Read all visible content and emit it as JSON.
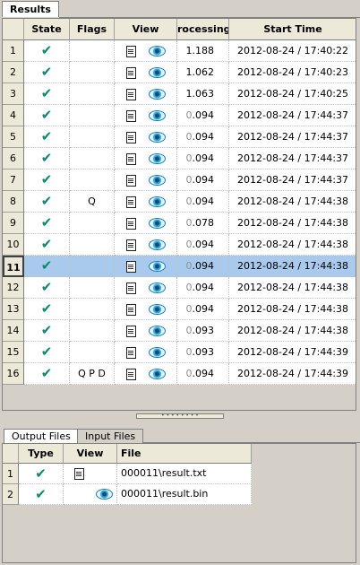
{
  "tabs": {
    "results": "Results"
  },
  "results": {
    "columns": [
      "State",
      "Flags",
      "View",
      "rocessing",
      "Start Time"
    ],
    "rows": [
      {
        "num": "1",
        "flags": "",
        "proc_lead": "",
        "proc": "1.188",
        "time": "2012-08-24 / 17:40:22"
      },
      {
        "num": "2",
        "flags": "",
        "proc_lead": "",
        "proc": "1.062",
        "time": "2012-08-24 / 17:40:23"
      },
      {
        "num": "3",
        "flags": "",
        "proc_lead": "",
        "proc": "1.063",
        "time": "2012-08-24 / 17:40:25"
      },
      {
        "num": "4",
        "flags": "",
        "proc_lead": "0",
        "proc": ".094",
        "time": "2012-08-24 / 17:44:37"
      },
      {
        "num": "5",
        "flags": "",
        "proc_lead": "0",
        "proc": ".094",
        "time": "2012-08-24 / 17:44:37"
      },
      {
        "num": "6",
        "flags": "",
        "proc_lead": "0",
        "proc": ".094",
        "time": "2012-08-24 / 17:44:37"
      },
      {
        "num": "7",
        "flags": "",
        "proc_lead": "0",
        "proc": ".094",
        "time": "2012-08-24 / 17:44:37"
      },
      {
        "num": "8",
        "flags": "Q",
        "proc_lead": "0",
        "proc": ".094",
        "time": "2012-08-24 / 17:44:38"
      },
      {
        "num": "9",
        "flags": "",
        "proc_lead": "0",
        "proc": ".078",
        "time": "2012-08-24 / 17:44:38"
      },
      {
        "num": "10",
        "flags": "",
        "proc_lead": "0",
        "proc": ".094",
        "time": "2012-08-24 / 17:44:38"
      },
      {
        "num": "11",
        "flags": "",
        "proc_lead": "0",
        "proc": ".094",
        "time": "2012-08-24 / 17:44:38"
      },
      {
        "num": "12",
        "flags": "",
        "proc_lead": "0",
        "proc": ".094",
        "time": "2012-08-24 / 17:44:38"
      },
      {
        "num": "13",
        "flags": "",
        "proc_lead": "0",
        "proc": ".094",
        "time": "2012-08-24 / 17:44:38"
      },
      {
        "num": "14",
        "flags": "",
        "proc_lead": "0",
        "proc": ".093",
        "time": "2012-08-24 / 17:44:38"
      },
      {
        "num": "15",
        "flags": "",
        "proc_lead": "0",
        "proc": ".093",
        "time": "2012-08-24 / 17:44:39"
      },
      {
        "num": "16",
        "flags": "Q P D",
        "proc_lead": "0",
        "proc": ".094",
        "time": "2012-08-24 / 17:44:39"
      }
    ],
    "selected_row": "11",
    "state_icon": "check-icon"
  },
  "bottom_tabs": {
    "output": "Output Files",
    "input": "Input Files"
  },
  "files": {
    "columns": [
      "Type",
      "View",
      "File"
    ],
    "rows": [
      {
        "num": "1",
        "view": "doc-icon",
        "file": "000011\\result.txt"
      },
      {
        "num": "2",
        "view": "eye-icon",
        "file": "000011\\result.bin"
      }
    ]
  },
  "colors": {
    "selection": "#a9c9ed",
    "check": "#0a8a6a",
    "eye": "#2fa6d8"
  }
}
